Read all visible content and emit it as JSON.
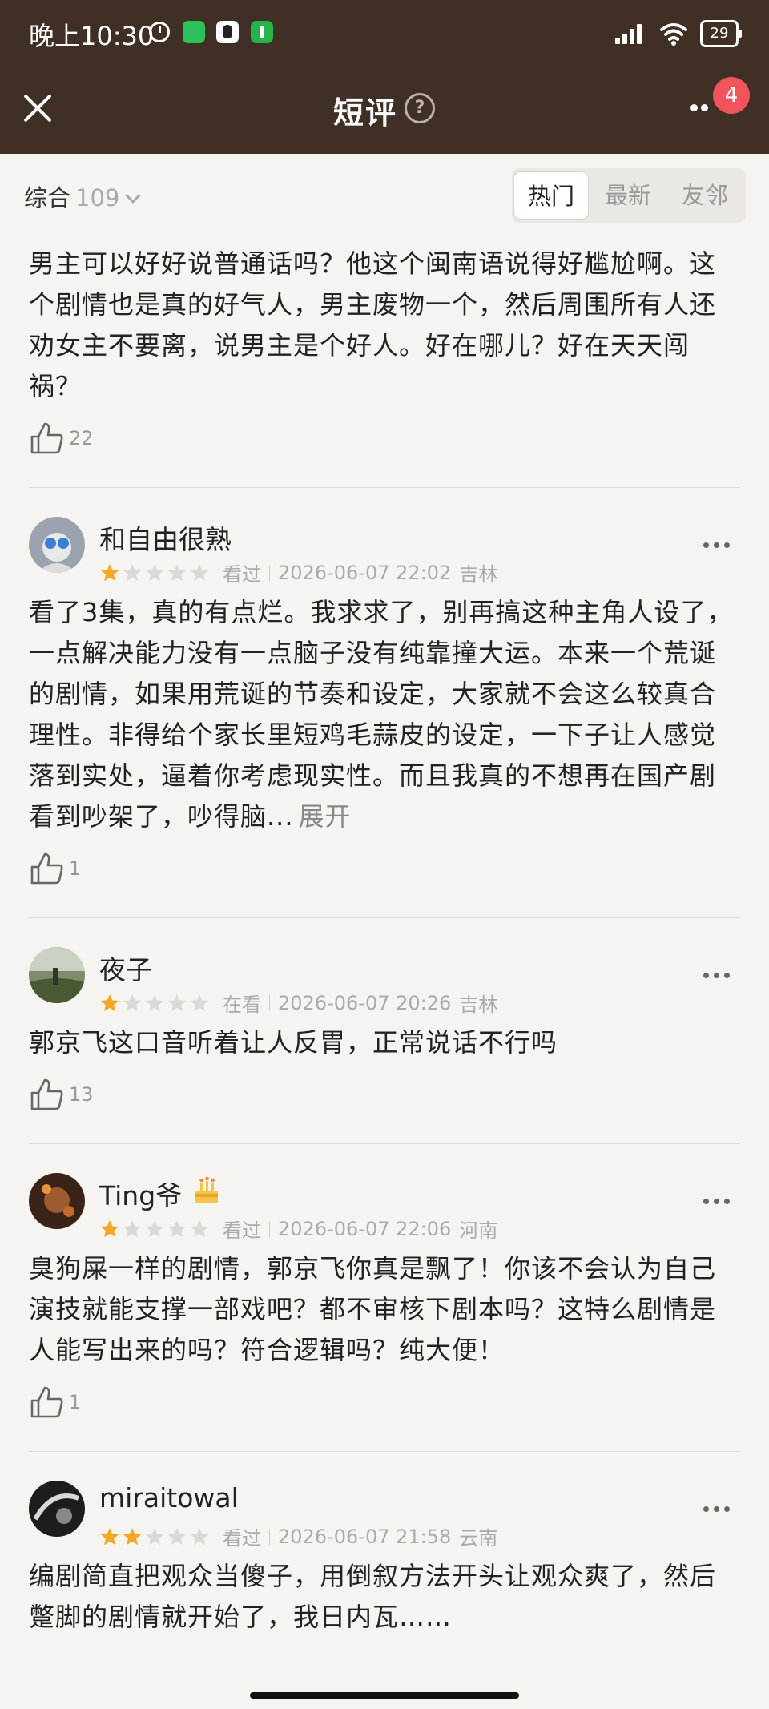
{
  "status_bar": {
    "time": "晚上10:30",
    "battery": "29"
  },
  "header": {
    "title": "短评",
    "notification_count": "4"
  },
  "filter": {
    "sort_label": "综合",
    "count": "109",
    "tabs": [
      {
        "label": "热门",
        "active": true
      },
      {
        "label": "最新",
        "active": false
      },
      {
        "label": "友邻",
        "active": false
      }
    ]
  },
  "partial_review": {
    "text": "男主可以好好说普通话吗？他这个闽南语说得好尴尬啊。这个剧情也是真的好气人，男主废物一个，然后周围所有人还劝女主不要离，说男主是个好人。好在哪儿？好在天天闯祸？",
    "likes": "22"
  },
  "reviews": [
    {
      "user": "和自由很熟",
      "rating": 1,
      "status": "看过",
      "datetime": "2026-06-07 22:02",
      "location": "吉林",
      "text": "看了3集，真的有点烂。我求求了，别再搞这种主角人设了，一点解决能力没有一点脑子没有纯靠撞大运。本来一个荒诞的剧情，如果用荒诞的节奏和设定，大家就不会这么较真合理性。非得给个家长里短鸡毛蒜皮的设定，一下子让人感觉落到实处，逼着你考虑现实性。而且我真的不想再在国产剧看到吵架了，吵得脑...",
      "expand": "展开",
      "likes": "1"
    },
    {
      "user": "夜子",
      "rating": 1,
      "status": "在看",
      "datetime": "2026-06-07 20:26",
      "location": "吉林",
      "text": "郭京飞这口音听着让人反胃，正常说话不行吗",
      "likes": "13"
    },
    {
      "user": "Ting爷",
      "rating": 1,
      "status": "看过",
      "datetime": "2026-06-07 22:06",
      "location": "河南",
      "text": "臭狗屎一样的剧情，郭京飞你真是飘了！你该不会认为自己演技就能支撑一部戏吧？都不审核下剧本吗？这特么剧情是人能写出来的吗？符合逻辑吗？纯大便！",
      "likes": "1"
    },
    {
      "user": "miraitowal",
      "rating": 2,
      "status": "看过",
      "datetime": "2026-06-07 21:58",
      "location": "云南",
      "text": "编剧简直把观众当傻子，用倒叙方法开头让观众爽了，然后蹩脚的剧情就开始了，我日内瓦……"
    }
  ],
  "colors": {
    "header_bg": "#3f2f25",
    "star_filled": "#f5a623",
    "star_empty": "#d9d9d9",
    "badge": "#f2545b"
  }
}
